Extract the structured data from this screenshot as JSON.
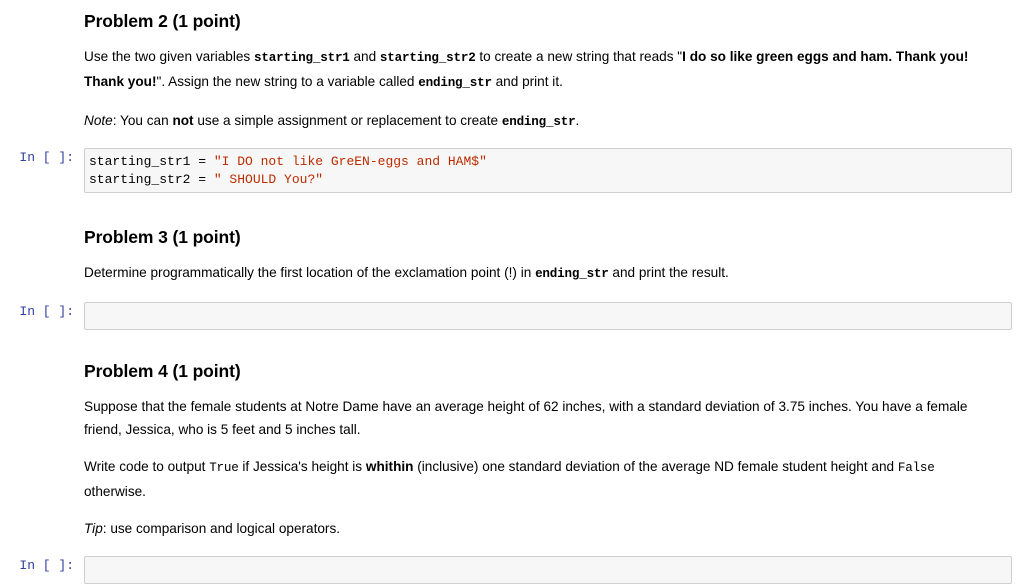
{
  "notebook": {
    "prompt_label": "In [ ]:",
    "cells": [
      {
        "type": "markdown",
        "heading": "Problem 2 (1 point)",
        "paragraphs": [
          {
            "id": "p2-body",
            "text": "Use the two given variables starting_str1 and starting_str2 to create a new string that reads \"I do so like green eggs and ham. Thank you! Thank you!\". Assign the new string to a variable called ending_str and print it."
          },
          {
            "id": "p2-note",
            "text": "Note: You can not use a simple assignment or replacement to create ending_str."
          }
        ]
      },
      {
        "type": "code",
        "source_lines": [
          "starting_str1 = \"I DO not like GreEN-eggs and HAM$\"",
          "starting_str2 = \" SHOULD You?\""
        ],
        "code_tokens": {
          "line1_name": "starting_str1 ",
          "line1_eq": "= ",
          "line1_str": "\"I DO not like GreEN-eggs and HAM$\"",
          "line2_name": "starting_str2 ",
          "line2_eq": "= ",
          "line2_str": "\" SHOULD You?\""
        }
      },
      {
        "type": "markdown",
        "heading": "Problem 3 (1 point)",
        "paragraphs": [
          {
            "id": "p3-body",
            "text": "Determine programmatically the first location of the exclamation point (!) in ending_str and print the result."
          }
        ]
      },
      {
        "type": "code",
        "source_lines": [],
        "empty": true
      },
      {
        "type": "markdown",
        "heading": "Problem 4 (1 point)",
        "paragraphs": [
          {
            "id": "p4-body",
            "text": "Suppose that the female students at Notre Dame have an average height of 62 inches, with a standard deviation of 3.75 inches. You have a female friend, Jessica, who is 5 feet and 5 inches tall."
          },
          {
            "id": "p4-write",
            "text": "Write code to output True if Jessica's height is whithin (inclusive) one standard deviation of the average ND female student height and False otherwise."
          },
          {
            "id": "p4-tip",
            "text": "Tip: use comparison and logical operators."
          }
        ]
      },
      {
        "type": "code",
        "source_lines": [],
        "empty": true
      }
    ]
  },
  "problem2": {
    "heading": "Problem 2 (1 point)",
    "body": {
      "t1": "Use the two given variables ",
      "code1": "starting_str1",
      "t2": " and ",
      "code2": "starting_str2",
      "t3": " to create a new string that reads \"",
      "quoted_bold": "I do so like green eggs and ham. Thank you! Thank you!",
      "t4": "\". Assign the new string to a variable called ",
      "code3": "ending_str",
      "t5": " and print it."
    },
    "note": {
      "label": "Note",
      "t1": ": You can ",
      "bold": "not",
      "t2": " use a simple assignment or replacement to create ",
      "code": "ending_str",
      "t3": "."
    }
  },
  "code_cell_1": {
    "prompt": "In [ ]:",
    "line1": {
      "name": "starting_str1 ",
      "op": "= ",
      "string": "\"I DO not like GreEN-eggs and HAM$\""
    },
    "line2": {
      "name": "starting_str2 ",
      "op": "= ",
      "string": "\" SHOULD You?\""
    }
  },
  "problem3": {
    "heading": "Problem 3 (1 point)",
    "body": {
      "t1": "Determine programmatically the first location of the exclamation point (!) in ",
      "code": "ending_str",
      "t2": " and print the result."
    },
    "cell_prompt": "In [ ]:"
  },
  "problem4": {
    "heading": "Problem 4 (1 point)",
    "body": {
      "t1": "Suppose that the female students at Notre Dame have an average height of 62 inches, with a standard deviation of 3.75 inches. You have a female friend, Jessica, who is 5 feet and 5 inches tall."
    },
    "write": {
      "t1": "Write code to output ",
      "code_true": "True",
      "t2": " if Jessica's height is ",
      "bold": "whithin",
      "t3": " (inclusive) one standard deviation of the average ND female student height and ",
      "code_false": "False",
      "t4": " otherwise."
    },
    "tip": {
      "label": "Tip",
      "t1": ": use comparison and logical operators."
    },
    "cell_prompt": "In [ ]:"
  },
  "colors": {
    "cell_background": "#f7f7f7",
    "cell_border": "#cfcfcf",
    "prompt_text": "#303f9f",
    "string_literal": "#bd2c00",
    "body_text": "#000000",
    "page_background": "#ffffff"
  }
}
